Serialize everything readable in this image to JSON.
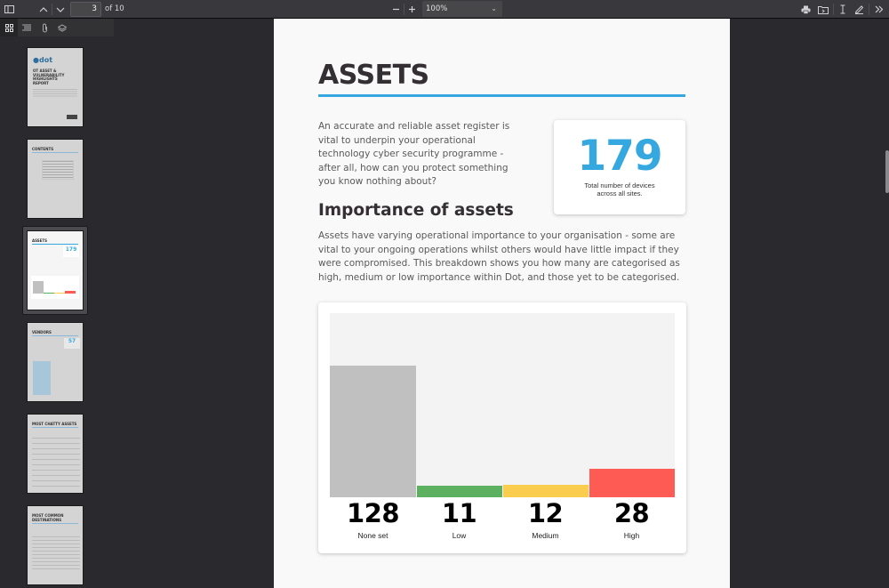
{
  "toolbar": {
    "current_page": "3",
    "page_count_label": "of 10",
    "zoom_level": "100%",
    "icons": {
      "sidebar_toggle": "sidebar-toggle-icon",
      "prev_page": "chevron-up-icon",
      "next_page": "chevron-down-icon",
      "zoom_out": "minus-icon",
      "zoom_in": "plus-icon",
      "print": "print-icon",
      "save": "save-icon",
      "text_select": "text-cursor-icon",
      "draw": "pencil-icon",
      "more": "double-chevron-right-icon"
    }
  },
  "sidebar": {
    "tools": [
      "thumbnails-icon",
      "outline-icon",
      "attachments-icon",
      "layers-icon"
    ],
    "thumbnails": [
      {
        "page": 1,
        "title": "OT ASSET & VULNERABILITY HIGHLIGHTS REPORT"
      },
      {
        "page": 2,
        "title": "CONTENTS"
      },
      {
        "page": 3,
        "title": "ASSETS",
        "selected": true
      },
      {
        "page": 4,
        "title": "VENDORS"
      },
      {
        "page": 5,
        "title": "MOST CHATTY ASSETS"
      },
      {
        "page": 6,
        "title": "MOST COMMON DESTINATIONS"
      }
    ]
  },
  "document": {
    "title": "ASSETS",
    "intro": "An accurate and reliable asset register is vital to underpin your operational technology cyber security programme - after all, how can you protect something you know nothing about?",
    "stat": {
      "value": "179",
      "label": "Total number of devices across all sites."
    },
    "subheading": "Importance of assets",
    "body": "Assets have varying operational importance to your organisation - some are vital to your ongoing operations whilst others would have little impact if they were compromised. This breakdown shows you how many are categorised as high, medium or low importance within Dot, and those yet to be categorised.",
    "accent_color": "#35a8e0"
  },
  "chart_data": {
    "type": "bar",
    "title": "",
    "xlabel": "",
    "ylabel": "",
    "categories": [
      "None set",
      "Low",
      "Medium",
      "High"
    ],
    "values": [
      128,
      11,
      12,
      28
    ],
    "value_labels": [
      "128",
      "11",
      "12",
      "28"
    ],
    "colors": [
      "#c0c0c0",
      "#5cb060",
      "#fbcd4e",
      "#fe5b55"
    ],
    "ylim": [
      0,
      179
    ],
    "grid": false,
    "legend": "none"
  }
}
